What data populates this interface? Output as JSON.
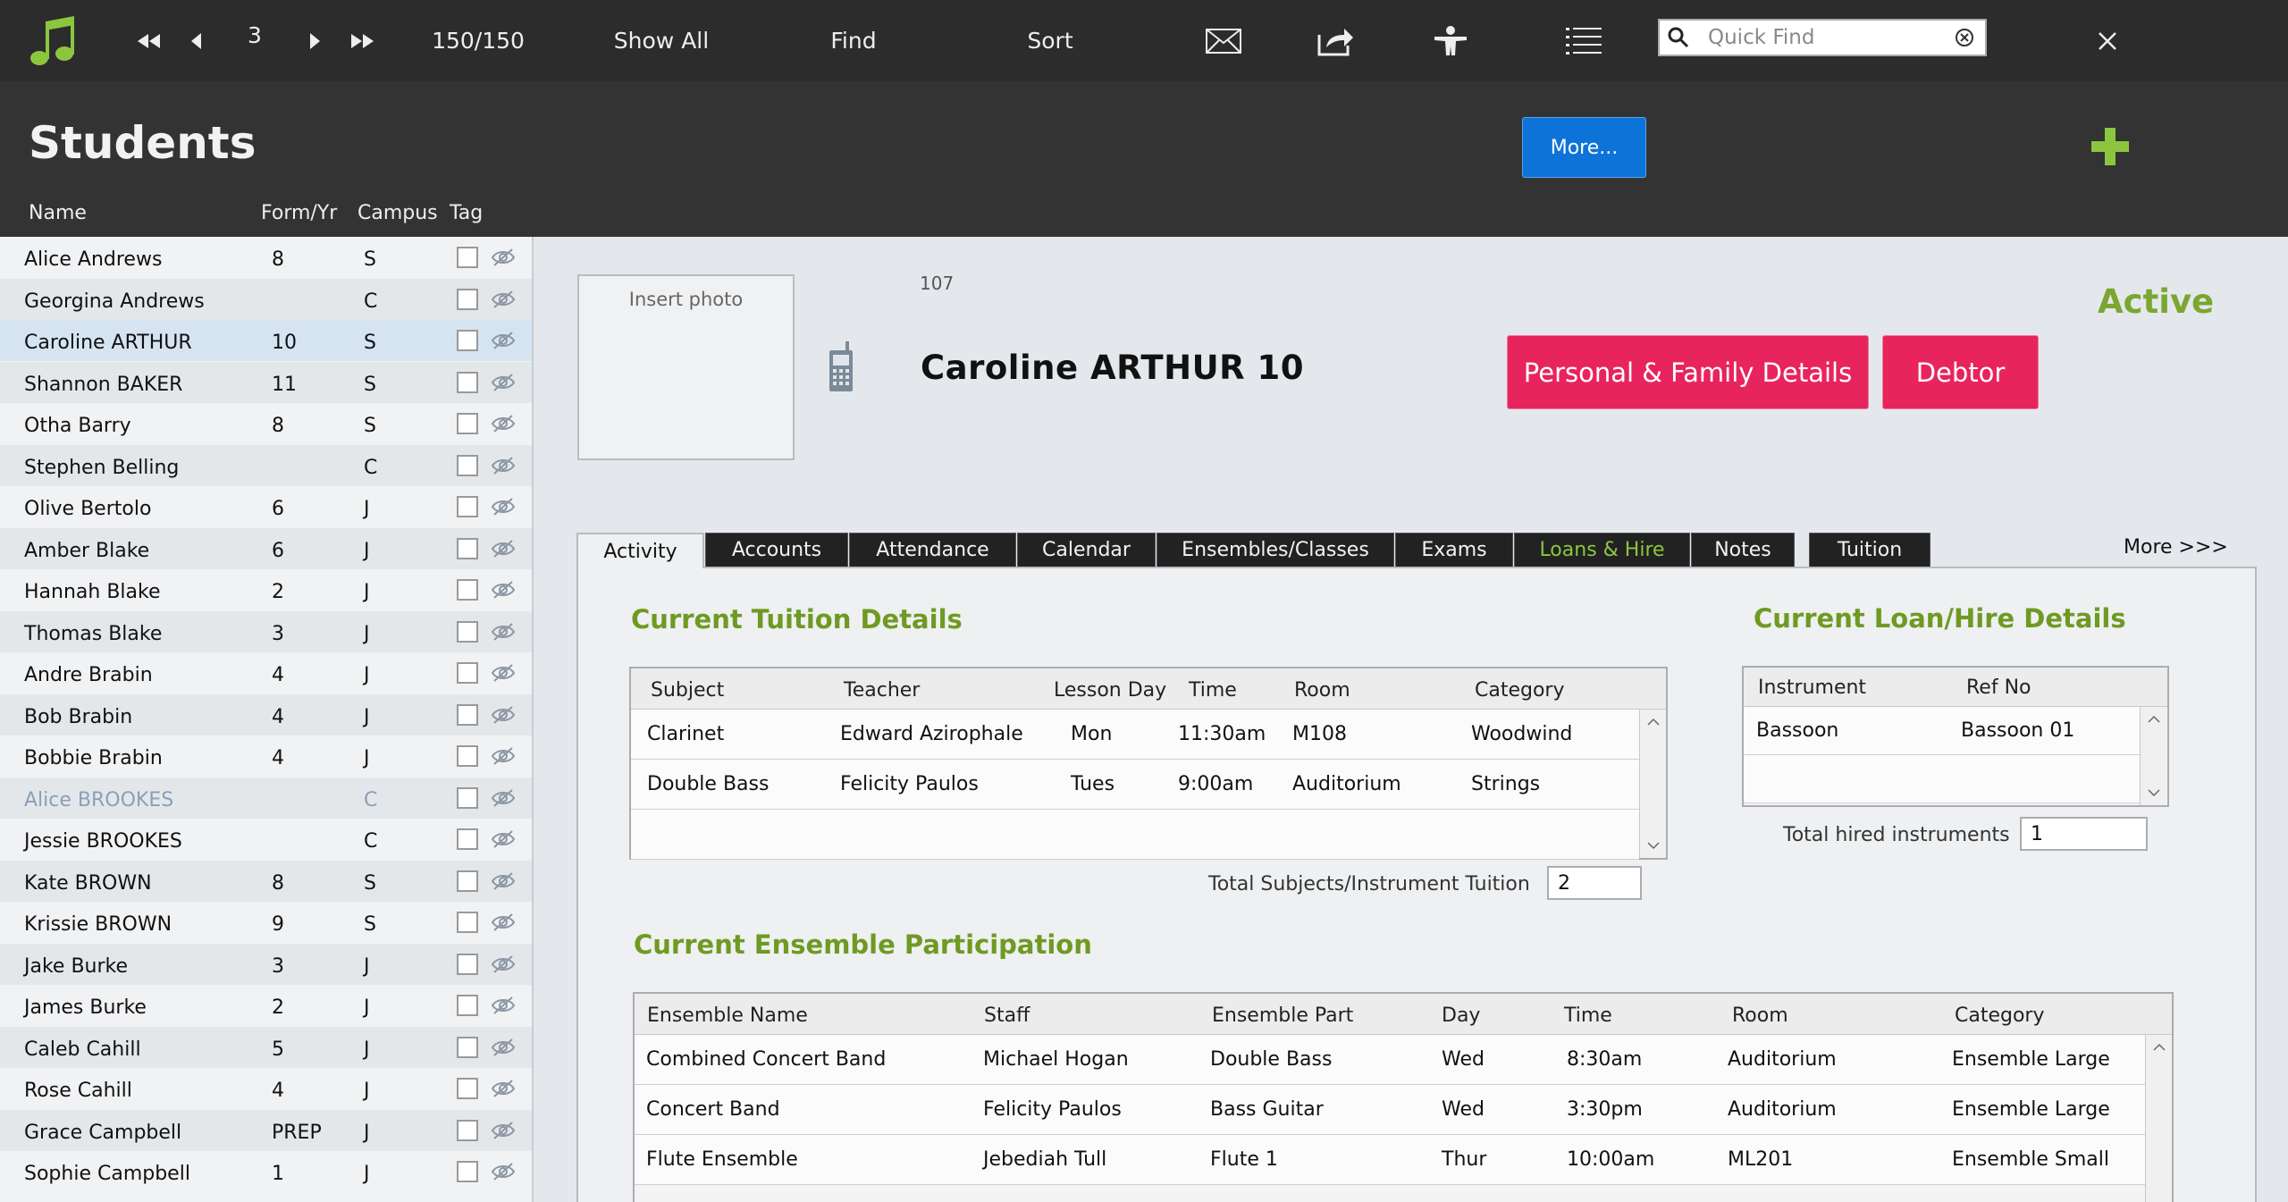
{
  "toolbar": {
    "record_number": "3",
    "record_count": "150/150",
    "show_all": "Show All",
    "find": "Find",
    "sort": "Sort",
    "quick_find_placeholder": "Quick Find"
  },
  "header": {
    "title": "Students",
    "more_button": "More...",
    "columns": {
      "name": "Name",
      "form": "Form/Yr",
      "campus": "Campus",
      "tag": "Tag"
    }
  },
  "students": [
    {
      "name": "Alice Andrews",
      "form": "8",
      "campus": "S"
    },
    {
      "name": "Georgina Andrews",
      "form": "",
      "campus": "C"
    },
    {
      "name": "Caroline ARTHUR",
      "form": "10",
      "campus": "S",
      "selected": true
    },
    {
      "name": "Shannon BAKER",
      "form": "11",
      "campus": "S"
    },
    {
      "name": "Otha Barry",
      "form": "8",
      "campus": "S"
    },
    {
      "name": "Stephen Belling",
      "form": "",
      "campus": "C"
    },
    {
      "name": "Olive Bertolo",
      "form": "6",
      "campus": "J"
    },
    {
      "name": "Amber Blake",
      "form": "6",
      "campus": "J"
    },
    {
      "name": "Hannah Blake",
      "form": "2",
      "campus": "J"
    },
    {
      "name": "Thomas Blake",
      "form": "3",
      "campus": "J"
    },
    {
      "name": "Andre Brabin",
      "form": "4",
      "campus": "J"
    },
    {
      "name": "Bob Brabin",
      "form": "4",
      "campus": "J"
    },
    {
      "name": "Bobbie Brabin",
      "form": "4",
      "campus": "J"
    },
    {
      "name": "Alice BROOKES",
      "form": "",
      "campus": "C",
      "dim": true
    },
    {
      "name": "Jessie BROOKES",
      "form": "",
      "campus": "C"
    },
    {
      "name": "Kate BROWN",
      "form": "8",
      "campus": "S"
    },
    {
      "name": "Krissie BROWN",
      "form": "9",
      "campus": "S"
    },
    {
      "name": "Jake Burke",
      "form": "3",
      "campus": "J"
    },
    {
      "name": "James Burke",
      "form": "2",
      "campus": "J"
    },
    {
      "name": "Caleb Cahill",
      "form": "5",
      "campus": "J"
    },
    {
      "name": "Rose Cahill",
      "form": "4",
      "campus": "J"
    },
    {
      "name": "Grace Campbell",
      "form": "PREP",
      "campus": "J"
    },
    {
      "name": "Sophie Campbell",
      "form": "1",
      "campus": "J"
    }
  ],
  "detail": {
    "photo_label": "Insert photo",
    "student_id": "107",
    "student_name": "Caroline ARTHUR  10",
    "status": "Active",
    "personal_button": "Personal & Family Details",
    "debtor_button": "Debtor",
    "more_tabs": "More >>>",
    "tabs": [
      "Activity",
      "Accounts",
      "Attendance",
      "Calendar",
      "Ensembles/Classes",
      "Exams",
      "Loans & Hire",
      "Notes",
      "Tuition"
    ],
    "tuition": {
      "title": "Current Tuition Details",
      "headers": [
        "Subject",
        "Teacher",
        "Lesson Day",
        "Time",
        "Room",
        "Category"
      ],
      "rows": [
        [
          "Clarinet",
          "Edward Azirophale",
          "Mon",
          "11:30am",
          "M108",
          "Woodwind"
        ],
        [
          "Double Bass",
          "Felicity Paulos",
          "Tues",
          "9:00am",
          "Auditorium",
          "Strings"
        ]
      ],
      "total_label": "Total Subjects/Instrument Tuition",
      "total_value": "2"
    },
    "loans": {
      "title": "Current Loan/Hire Details",
      "headers": [
        "Instrument",
        "Ref No"
      ],
      "rows": [
        [
          "Bassoon",
          "Bassoon 01"
        ]
      ],
      "total_label": "Total hired instruments",
      "total_value": "1"
    },
    "ensembles": {
      "title": "Current Ensemble Participation",
      "headers": [
        "Ensemble Name",
        "Staff",
        "Ensemble Part",
        "Day",
        "Time",
        "Room",
        "Category"
      ],
      "rows": [
        [
          "Combined Concert Band",
          "Michael Hogan",
          "Double Bass",
          "Wed",
          "8:30am",
          "Auditorium",
          "Ensemble Large"
        ],
        [
          "Concert Band",
          "Felicity Paulos",
          "Bass Guitar",
          "Wed",
          "3:30pm",
          "Auditorium",
          "Ensemble Large"
        ],
        [
          "Flute Ensemble",
          "Jebediah Tull",
          "Flute 1",
          "Thur",
          "10:00am",
          "ML201",
          "Ensemble Small"
        ]
      ]
    }
  },
  "colors": {
    "accent_green": "#7ba631",
    "pink_button": "#e8245c",
    "blue_button": "#0d73d9",
    "toolbar_bg": "#2c2c2c"
  }
}
